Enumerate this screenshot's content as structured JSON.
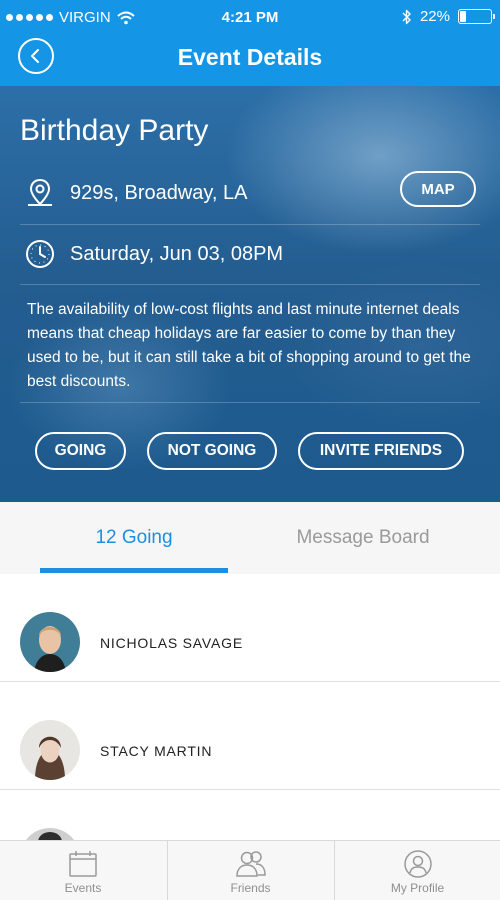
{
  "status": {
    "carrier": "VIRGIN",
    "time": "4:21 PM",
    "battery": "22%",
    "battery_level": 0.22
  },
  "nav": {
    "title": "Event Details",
    "back_icon": "chevron-left-icon"
  },
  "event": {
    "title": "Birthday Party",
    "location": "929s, Broadway, LA",
    "datetime": "Saturday, Jun 03, 08PM",
    "map_label": "MAP",
    "description": "The availability of low-cost flights and last minute internet deals means that cheap holidays are far easier to come by than they used to be, but it can still take a bit of shopping around to get the best discounts.",
    "actions": {
      "going": "GOING",
      "not_going": "NOT GOING",
      "invite": "INVITE FRIENDS"
    }
  },
  "tabs": [
    {
      "label": "12 Going",
      "active": true
    },
    {
      "label": "Message Board",
      "active": false
    }
  ],
  "attendees": [
    {
      "name": "NICHOLAS SAVAGE"
    },
    {
      "name": "STACY MARTIN"
    }
  ],
  "bottom_nav": [
    {
      "label": "Events",
      "icon": "calendar-icon"
    },
    {
      "label": "Friends",
      "icon": "friends-icon"
    },
    {
      "label": "My Profile",
      "icon": "profile-icon"
    }
  ],
  "colors": {
    "primary": "#1595e6",
    "tab_active": "#1d8fe0",
    "tab_inactive": "#9a9a9a"
  }
}
